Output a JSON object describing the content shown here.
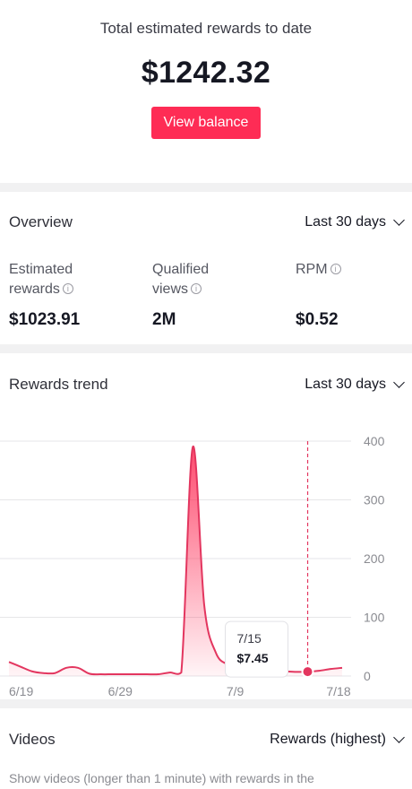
{
  "summary": {
    "caption": "Total estimated rewards to date",
    "amount": "$1242.32",
    "button_label": "View balance"
  },
  "overview": {
    "title": "Overview",
    "range_label": "Last 30 days",
    "metrics": [
      {
        "label_line1": "Estimated",
        "label_line2": "rewards",
        "value": "$1023.91"
      },
      {
        "label_line1": "Qualified",
        "label_line2": "views",
        "value": "2M"
      },
      {
        "label_line1": "RPM",
        "label_line2": "",
        "value": "$0.52"
      }
    ]
  },
  "trend": {
    "title": "Rewards trend",
    "range_label": "Last 30 days",
    "tooltip": {
      "date": "7/15",
      "value": "$7.45"
    }
  },
  "videos": {
    "title": "Videos",
    "sort_label": "Rewards (highest)",
    "description": "Show videos (longer than 1 minute) with rewards in the"
  },
  "colors": {
    "accent": "#fe2c55",
    "line": "#e3365f"
  },
  "chart_data": {
    "type": "area",
    "x": [
      "6/19",
      "6/20",
      "6/21",
      "6/22",
      "6/23",
      "6/24",
      "6/25",
      "6/26",
      "6/27",
      "6/28",
      "6/29",
      "6/30",
      "7/1",
      "7/2",
      "7/3",
      "7/4",
      "7/5",
      "7/6",
      "7/7",
      "7/8",
      "7/9",
      "7/10",
      "7/11",
      "7/12",
      "7/13",
      "7/14",
      "7/15",
      "7/16",
      "7/17",
      "7/18"
    ],
    "values": [
      24,
      16,
      8,
      5,
      5,
      14,
      14,
      4,
      3,
      3,
      3,
      3,
      3,
      3,
      6,
      6,
      390,
      120,
      40,
      20,
      14,
      12,
      10,
      9,
      8,
      7,
      7.45,
      9,
      12,
      14
    ],
    "x_tick_labels": [
      "6/19",
      "6/29",
      "7/9",
      "7/18"
    ],
    "y_ticks": [
      0,
      100,
      200,
      300,
      400
    ],
    "ylim": [
      0,
      400
    ],
    "highlight": "7/15",
    "grid": true
  }
}
